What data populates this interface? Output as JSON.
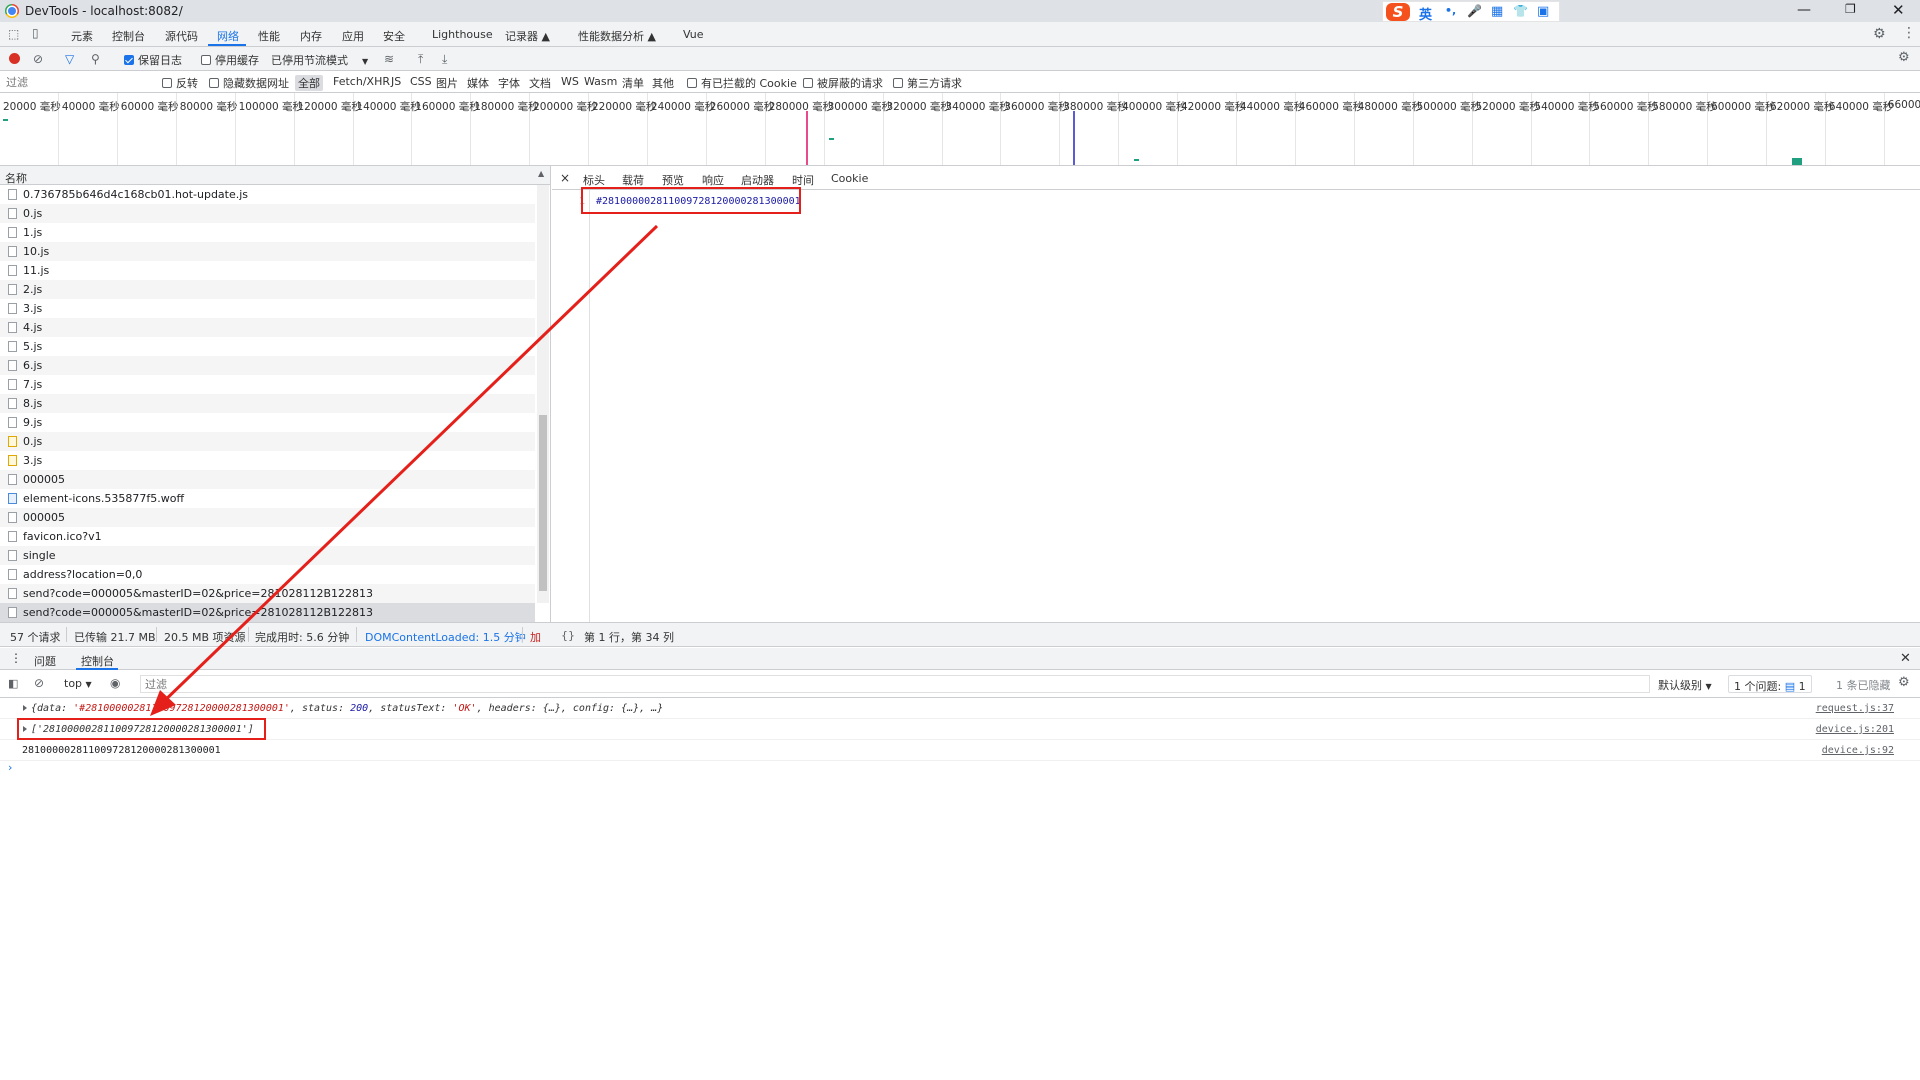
{
  "window": {
    "title": "DevTools - localhost:8082/"
  },
  "ime": {
    "items": [
      "英",
      "•,",
      "🎤",
      "▦",
      "👕",
      "▣"
    ]
  },
  "panel_tabs": [
    {
      "label": "元素"
    },
    {
      "label": "控制台"
    },
    {
      "label": "源代码"
    },
    {
      "label": "网络",
      "active": true
    },
    {
      "label": "性能"
    },
    {
      "label": "内存"
    },
    {
      "label": "应用"
    },
    {
      "label": "安全"
    },
    {
      "label": "Lighthouse"
    },
    {
      "label": "记录器 ▲"
    },
    {
      "label": "性能数据分析 ▲"
    },
    {
      "label": "Vue"
    }
  ],
  "issues_badge": "1",
  "network_toolbar": {
    "preserve_log": "保留日志",
    "disable_cache": "停用缓存",
    "throttle": "已停用节流模式"
  },
  "filter_row": {
    "placeholder": "过滤",
    "invert": "反转",
    "hide_data_urls": "隐藏数据网址",
    "types": [
      "全部",
      "Fetch/XHR",
      "JS",
      "CSS",
      "图片",
      "媒体",
      "字体",
      "文档",
      "WS",
      "Wasm",
      "清单",
      "其他"
    ],
    "blocked_cookies": "有已拦截的 Cookie",
    "blocked_requests": "被屏蔽的请求",
    "third_party": "第三方请求"
  },
  "timeline": {
    "ticks": [
      "20000 毫秒",
      "40000 毫秒",
      "60000 毫秒",
      "80000 毫秒",
      "100000 毫秒",
      "120000 毫秒",
      "140000 毫秒",
      "160000 毫秒",
      "180000 毫秒",
      "200000 毫秒",
      "220000 毫秒",
      "240000 毫秒",
      "260000 毫秒",
      "280000 毫秒",
      "300000 毫秒",
      "320000 毫秒",
      "340000 毫秒",
      "360000 毫秒",
      "380000 毫秒",
      "400000 毫秒",
      "420000 毫秒",
      "440000 毫秒",
      "460000 毫秒",
      "480000 毫秒",
      "500000 毫秒",
      "520000 毫秒",
      "540000 毫秒",
      "560000 毫秒",
      "580000 毫秒",
      "600000 毫秒",
      "620000 毫秒",
      "640000 毫秒",
      "660000"
    ]
  },
  "request_list": {
    "header": "名称",
    "rows": [
      {
        "name": "0.736785b646d4c168cb01.hot-update.js",
        "icon": "plain"
      },
      {
        "name": "0.js",
        "icon": "plain"
      },
      {
        "name": "1.js",
        "icon": "plain"
      },
      {
        "name": "10.js",
        "icon": "plain"
      },
      {
        "name": "11.js",
        "icon": "plain"
      },
      {
        "name": "2.js",
        "icon": "plain"
      },
      {
        "name": "3.js",
        "icon": "plain"
      },
      {
        "name": "4.js",
        "icon": "plain"
      },
      {
        "name": "5.js",
        "icon": "plain"
      },
      {
        "name": "6.js",
        "icon": "plain"
      },
      {
        "name": "7.js",
        "icon": "plain"
      },
      {
        "name": "8.js",
        "icon": "plain"
      },
      {
        "name": "9.js",
        "icon": "plain"
      },
      {
        "name": "0.js",
        "icon": "yellow"
      },
      {
        "name": "3.js",
        "icon": "yellow"
      },
      {
        "name": "000005",
        "icon": "plain"
      },
      {
        "name": "element-icons.535877f5.woff",
        "icon": "blue"
      },
      {
        "name": "000005",
        "icon": "plain"
      },
      {
        "name": "favicon.ico?v1",
        "icon": "plain"
      },
      {
        "name": "single",
        "icon": "plain"
      },
      {
        "name": "address?location=0,0",
        "icon": "plain"
      },
      {
        "name": "send?code=000005&masterID=02&price=281028112B122813",
        "icon": "plain"
      },
      {
        "name": "send?code=000005&masterID=02&price=281028112B122813",
        "icon": "plain",
        "selected": true
      }
    ]
  },
  "status_bar": {
    "requests": "57 个请求",
    "transferred": "已传输 21.7 MB",
    "resources": "20.5 MB 项资源",
    "finish": "完成用时: 5.6 分钟",
    "dcl": "DOMContentLoaded: 1.5 分钟",
    "load": "加",
    "cursor": "第 1 行，第 34 列"
  },
  "detail_tabs": [
    "标头",
    "载荷",
    "预览",
    "响应",
    "启动器",
    "时间",
    "Cookie"
  ],
  "response": {
    "line_no": "1",
    "line_text": "#281000002811009728120000281300001"
  },
  "drawer": {
    "tabs": [
      "问题",
      "控制台"
    ],
    "context": "top",
    "filter_placeholder": "过滤",
    "levels": "默认级别",
    "issues": "1 个问题:",
    "issues_count": "1",
    "hidden": "1 条已隐藏"
  },
  "console": {
    "lines": [
      {
        "kind": "object",
        "prefix": "{data: ",
        "data_str": "'#281000002811009728120000281300001'",
        "mid": ", status: ",
        "status_num": "200",
        "mid2": ", statusText: ",
        "status_text": "'OK'",
        "suffix": ", headers: {…}, config: {…}, …}",
        "source": "request.js:37"
      },
      {
        "kind": "array",
        "text": "['281000002811009728120000281300001']",
        "source": "device.js:201"
      },
      {
        "kind": "plain",
        "text": "281000002811009728120000281300001",
        "source": "device.js:92"
      }
    ]
  },
  "colors": {
    "accent": "#1a73e8",
    "annotation": "#e5201a",
    "record": "#d93025"
  }
}
